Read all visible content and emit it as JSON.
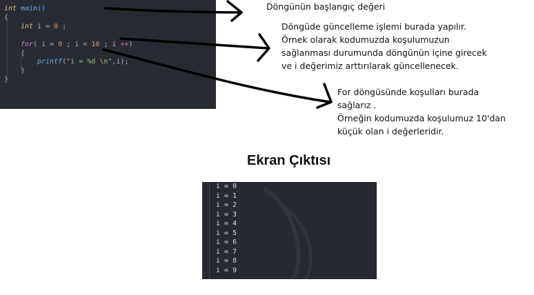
{
  "code": {
    "line1": {
      "type": "int",
      "rest": " main()"
    },
    "line2": "{",
    "line3": {
      "type": "int",
      "var": " i = ",
      "num": "0",
      "end": " ;"
    },
    "line4": {
      "kw": "for",
      "p1": "( i = ",
      "n1": "0",
      "p2": " ; i < ",
      "n2": "10",
      "p3": " ; i ",
      "op": "++",
      "p4": ")"
    },
    "line5": "{",
    "line6": {
      "fn": "printf",
      "p1": "(",
      "str": "\"i = %d \\n\"",
      "p2": ",i);"
    },
    "line7": "}",
    "line8": "}"
  },
  "notes": {
    "init": "Döngünün başlangıç değeri",
    "update": [
      "Döngüde güncelleme işlemi burada yapılır.",
      "Örnek olarak kodumuzda koşulumuzun",
      "sağlanması durumunda döngünün içine girecek",
      "ve i değerimiz arttırılarak güncellenecek."
    ],
    "condition": [
      "For döngüsünde koşulları burada",
      "sağlarız .",
      "Örneğin kodumuzda koşulumuz 10'dan",
      "küçük olan i değerleridir."
    ]
  },
  "output_title": "Ekran Çıktısı",
  "terminal_lines": [
    "i = 0",
    "i = 1",
    "i = 2",
    "i = 3",
    "i = 4",
    "i = 5",
    "i = 6",
    "i = 7",
    "i = 8",
    "i = 9"
  ],
  "colors": {
    "editor_bg": "#272b33",
    "terminal_bg": "#252a32",
    "arrow": "#000000"
  }
}
